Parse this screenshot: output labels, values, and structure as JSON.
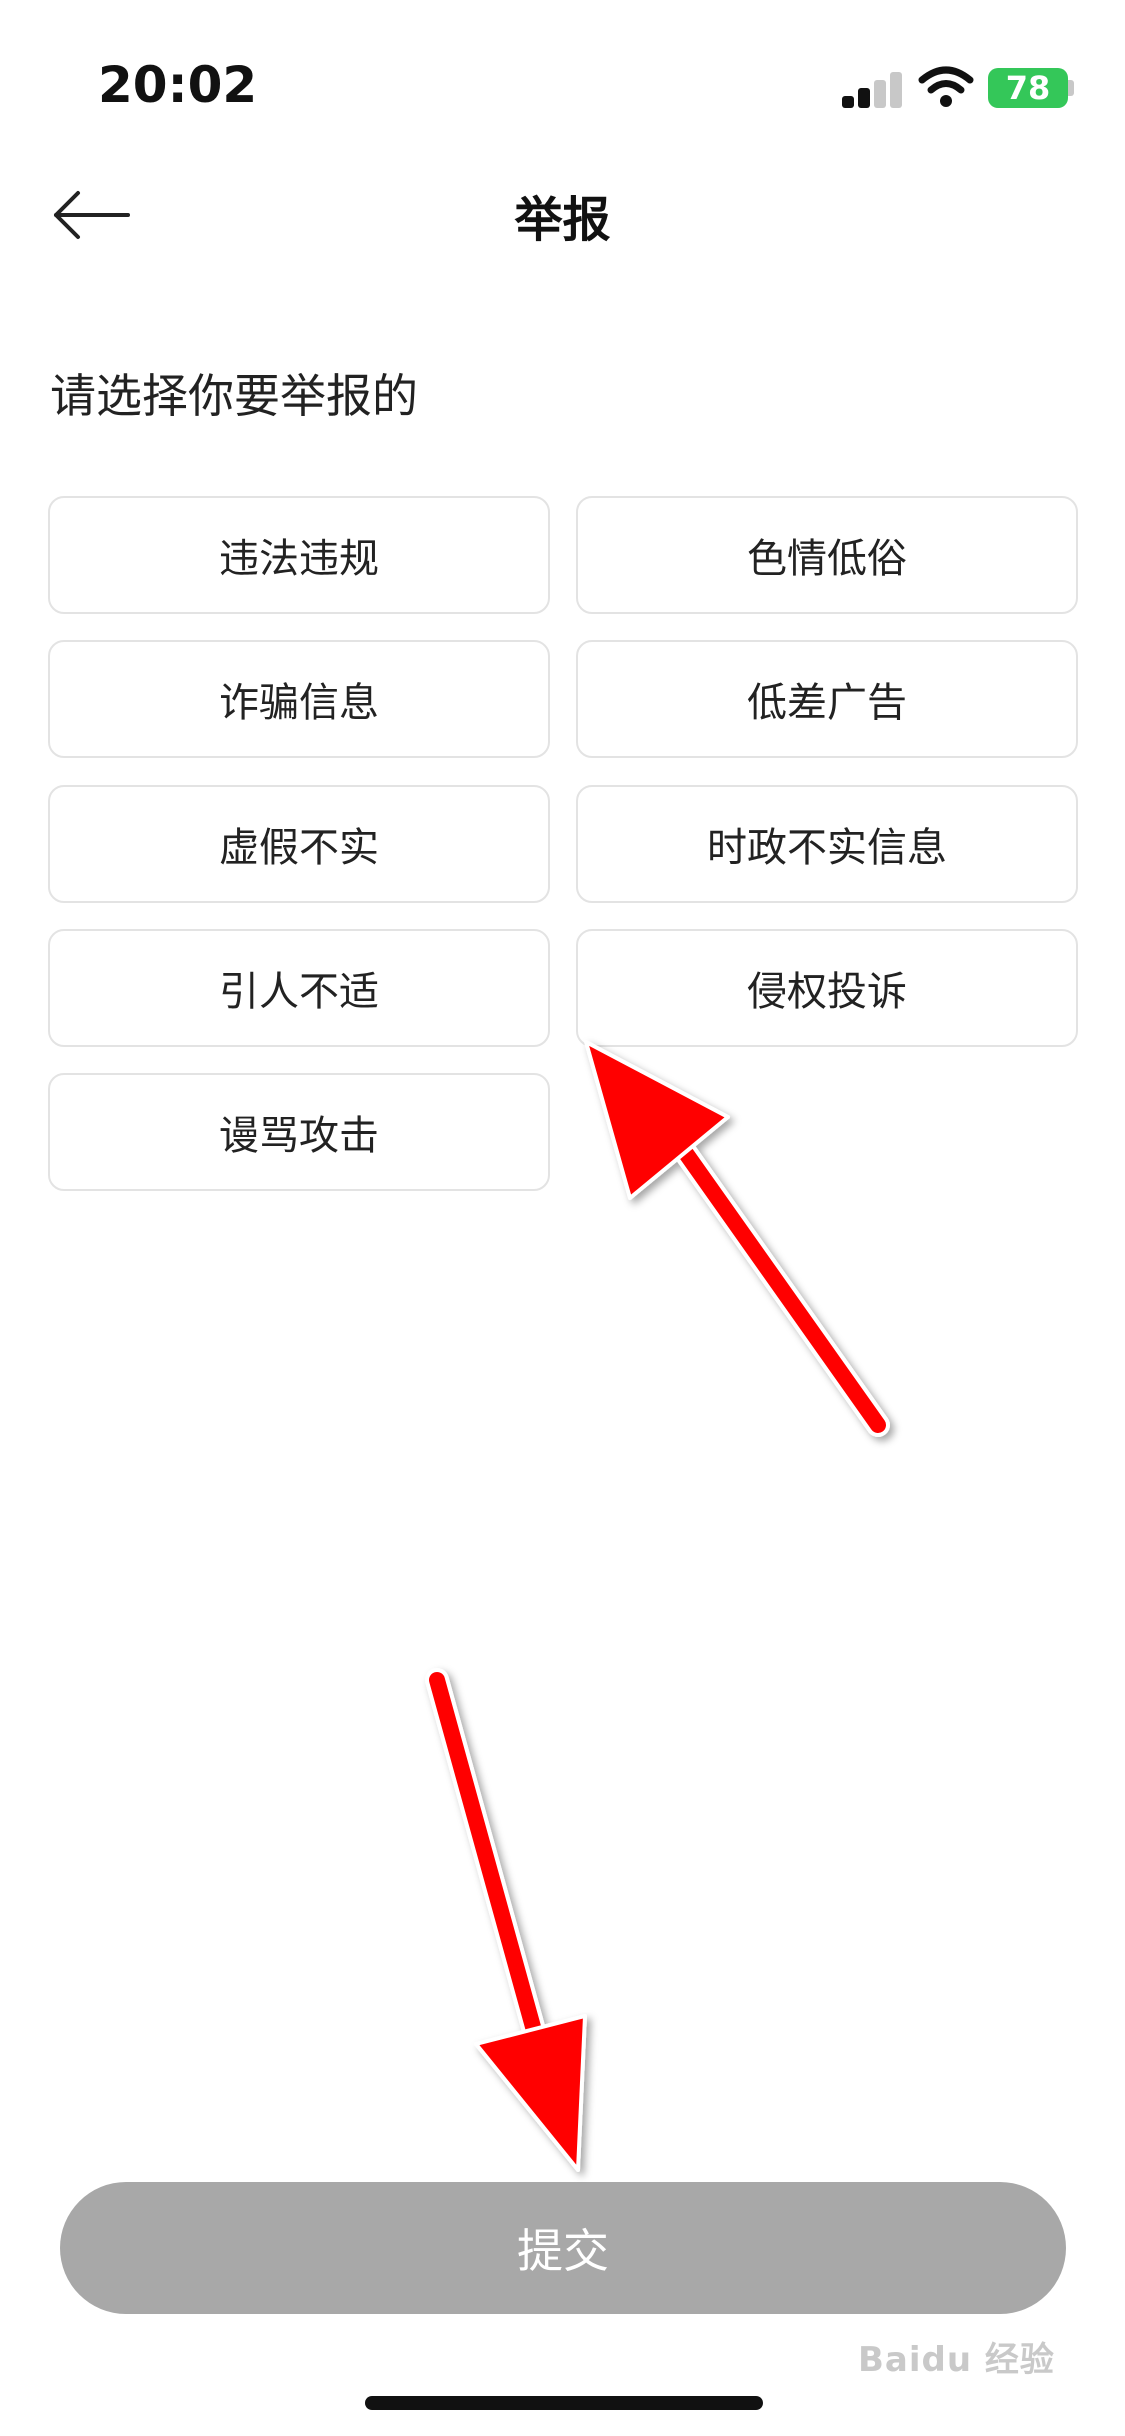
{
  "status_bar": {
    "time": "20:02",
    "battery_level": "78",
    "icons": [
      "signal-icon",
      "wifi-icon",
      "battery-icon"
    ]
  },
  "header": {
    "title": "举报",
    "back_icon": "arrow-left-icon"
  },
  "prompt": "请选择你要举报的",
  "options": [
    {
      "label": "违法违规"
    },
    {
      "label": "色情低俗"
    },
    {
      "label": "诈骗信息"
    },
    {
      "label": "低差广告"
    },
    {
      "label": "虚假不实"
    },
    {
      "label": "时政不实信息"
    },
    {
      "label": "引人不适"
    },
    {
      "label": "侵权投诉"
    },
    {
      "label": "谩骂攻击"
    }
  ],
  "submit": {
    "label": "提交",
    "enabled": false
  },
  "colors": {
    "battery": "#34c759",
    "submit_disabled": "#a8a8a8",
    "annotation_arrow": "#ff0000",
    "option_border": "#e3e3e3"
  },
  "watermark": "Baidu 经验"
}
